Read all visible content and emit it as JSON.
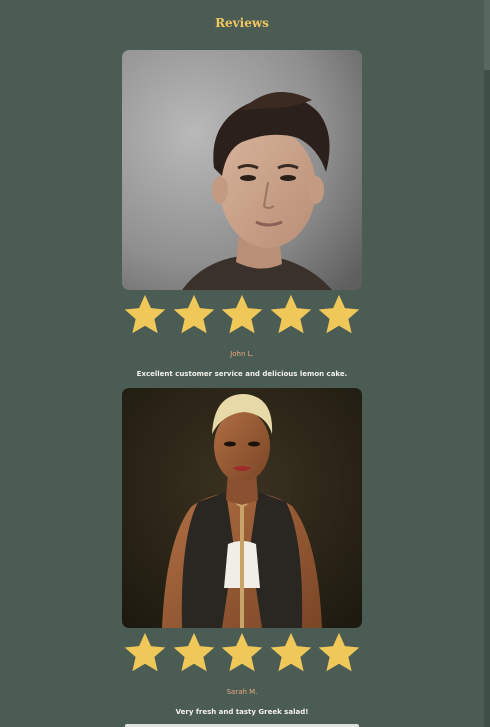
{
  "section": {
    "title": "Reviews"
  },
  "reviews": [
    {
      "photo_alt": "Young man with dark wavy hair",
      "rating": 5,
      "max_rating": 5,
      "reviewer": "John L.",
      "text": "Excellent customer service and delicious lemon cake."
    },
    {
      "photo_alt": "Woman with short platinum hair in dark vest",
      "rating": 5,
      "max_rating": 5,
      "reviewer": "Sarah M.",
      "text": "Very fresh and tasty Greek salad!"
    }
  ],
  "colors": {
    "background": "#4a5c54",
    "title": "#f2c65e",
    "star": "#f0c85a",
    "reviewer": "#e9a87b",
    "quote": "#f3f1ea"
  }
}
